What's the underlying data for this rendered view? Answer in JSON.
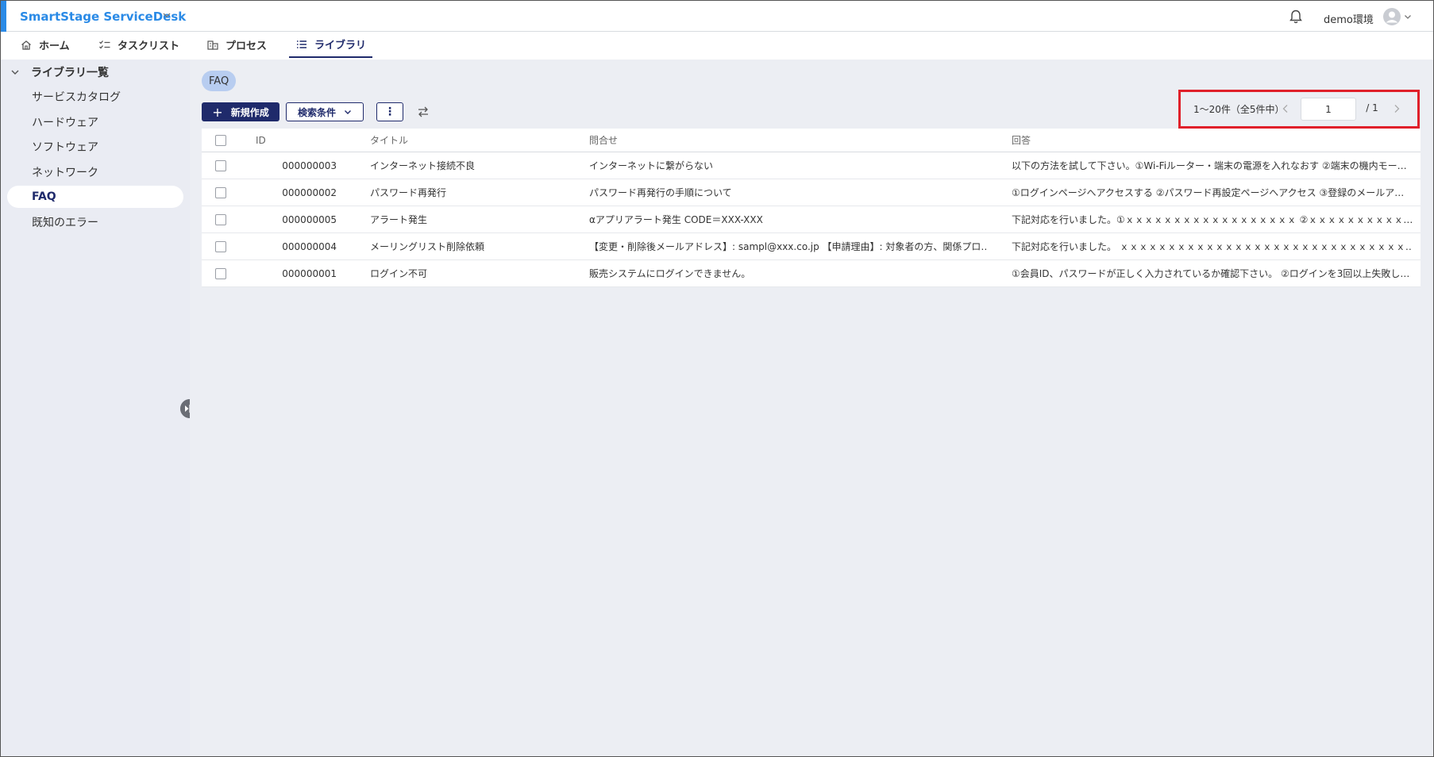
{
  "header": {
    "app_title": "SmartStage ServiceDesk",
    "env_label": "demo環境"
  },
  "nav": {
    "tabs": [
      {
        "label": "ホーム",
        "icon": "home-icon"
      },
      {
        "label": "タスクリスト",
        "icon": "checklist-icon"
      },
      {
        "label": "プロセス",
        "icon": "process-icon"
      },
      {
        "label": "ライブラリ",
        "icon": "list-icon",
        "active": true
      }
    ]
  },
  "sidebar": {
    "heading": "ライブラリ一覧",
    "items": [
      {
        "label": "サービスカタログ"
      },
      {
        "label": "ハードウェア"
      },
      {
        "label": "ソフトウェア"
      },
      {
        "label": "ネットワーク"
      },
      {
        "label": "FAQ",
        "active": true
      },
      {
        "label": "既知のエラー"
      }
    ]
  },
  "main": {
    "chip": "FAQ",
    "new_button": "新規作成",
    "search_button": "検索条件",
    "more_button": "⋮"
  },
  "pager": {
    "range_text": "1〜20件（全5件中）",
    "current_page": "1",
    "total_text": "/ 1"
  },
  "table": {
    "headers": {
      "id": "ID",
      "title": "タイトル",
      "inquiry": "問合せ",
      "answer": "回答"
    },
    "rows": [
      {
        "id": "000000003",
        "title": "インターネット接続不良",
        "inquiry": "インターネットに繋がらない",
        "answer": "以下の方法を試して下さい。①Wi-Fiルーター・端末の電源を入れなおす ②端末の機内モー…"
      },
      {
        "id": "000000002",
        "title": "パスワード再発行",
        "inquiry": "パスワード再発行の手順について",
        "answer": "①ログインページへアクセスする ②パスワード再設定ページへアクセス ③登録のメールア…"
      },
      {
        "id": "000000005",
        "title": "アラート発生",
        "inquiry": "αアプリアラート発生 CODE＝XXX-XXX",
        "answer": "下記対応を行いました。①ｘｘｘｘｘｘｘｘｘｘｘｘｘｘｘｘｘｘ ②ｘｘｘｘｘｘｘｘｘｘ…"
      },
      {
        "id": "000000004",
        "title": "メーリングリスト削除依頼",
        "inquiry": "【変更・削除後メールアドレス】: sampl@xxx.co.jp 【申請理由】: 対象者の方、関係プロ…",
        "answer": "下記対応を行いました。 ｘｘｘｘｘｘｘｘｘｘｘｘｘｘｘｘｘｘｘｘｘｘｘｘｘｘｘｘｘｘ…"
      },
      {
        "id": "000000001",
        "title": "ログイン不可",
        "inquiry": "販売システムにログインできません。",
        "answer": "①会員ID、パスワードが正しく入力されているか確認下さい。 ②ログインを3回以上失敗し…"
      }
    ]
  }
}
